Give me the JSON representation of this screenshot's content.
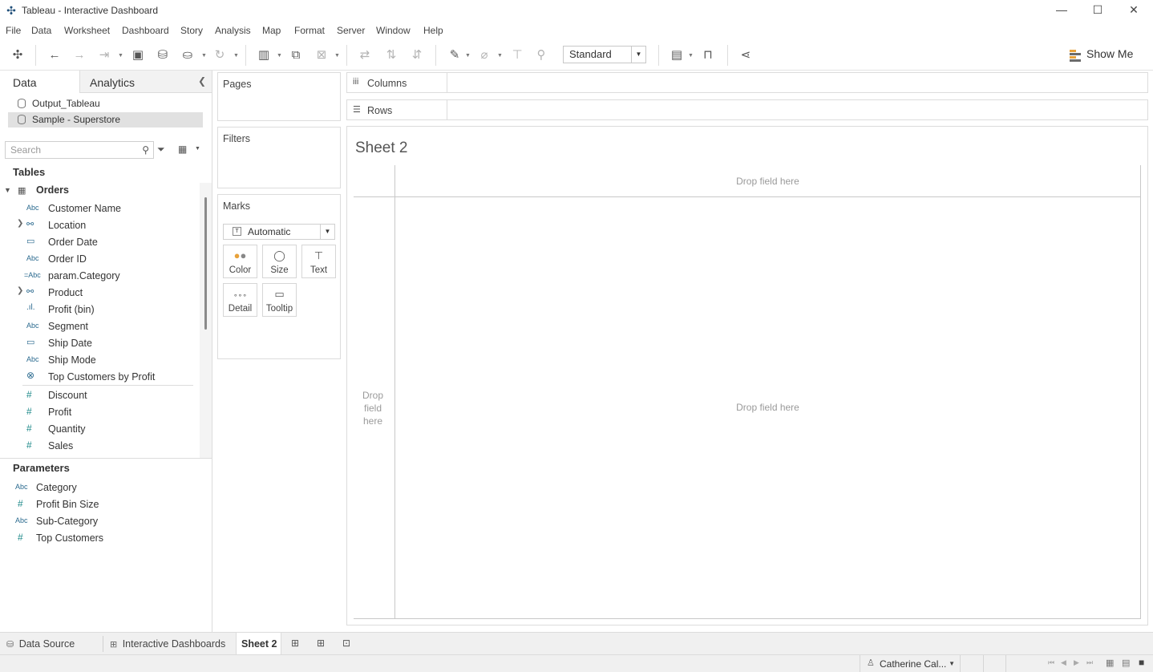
{
  "window": {
    "title": "Tableau - Interactive Dashboard",
    "minimize": "—",
    "maximize": "☐",
    "close": "✕"
  },
  "menu": [
    "File",
    "Data",
    "Worksheet",
    "Dashboard",
    "Story",
    "Analysis",
    "Map",
    "Format",
    "Server",
    "Window",
    "Help"
  ],
  "toolbar": {
    "fit_value": "Standard",
    "show_me_label": "Show Me"
  },
  "data_pane": {
    "tab_data": "Data",
    "tab_analytics": "Analytics",
    "datasources": [
      "Output_Tableau",
      "Sample - Superstore"
    ],
    "search_placeholder": "Search",
    "tables_header": "Tables",
    "table_name": "Orders",
    "dimensions": [
      {
        "type": "Abc",
        "name": "Customer Name"
      },
      {
        "type": "",
        "name": "Location"
      },
      {
        "type": "",
        "name": "Order Date"
      },
      {
        "type": "Abc",
        "name": "Order ID"
      },
      {
        "type": "=Abc",
        "name": "param.Category"
      },
      {
        "type": "",
        "name": "Product"
      },
      {
        "type": "",
        "name": "Profit (bin)"
      },
      {
        "type": "Abc",
        "name": "Segment"
      },
      {
        "type": "",
        "name": "Ship Date"
      },
      {
        "type": "Abc",
        "name": "Ship Mode"
      },
      {
        "type": "",
        "name": "Top Customers by Profit"
      }
    ],
    "measures": [
      {
        "type": "#",
        "name": "Discount"
      },
      {
        "type": "#",
        "name": "Profit"
      },
      {
        "type": "#",
        "name": "Quantity"
      },
      {
        "type": "#",
        "name": "Sales"
      }
    ],
    "parameters_header": "Parameters",
    "parameters": [
      {
        "type": "Abc",
        "name": "Category"
      },
      {
        "type": "#",
        "name": "Profit Bin Size"
      },
      {
        "type": "Abc",
        "name": "Sub-Category"
      },
      {
        "type": "#",
        "name": "Top Customers"
      }
    ]
  },
  "cards": {
    "pages": "Pages",
    "filters": "Filters",
    "marks": "Marks",
    "marks_type": "Automatic",
    "mark_buttons": [
      "Color",
      "Size",
      "Text",
      "Detail",
      "Tooltip"
    ]
  },
  "shelves": {
    "columns": "Columns",
    "rows": "Rows"
  },
  "view": {
    "sheet_title": "Sheet 2",
    "drop_top": "Drop field here",
    "drop_left": "Drop field here",
    "drop_center": "Drop field here"
  },
  "tabs": {
    "data_source": "Data Source",
    "dashboard": "Interactive Dashboards",
    "active_sheet": "Sheet 2"
  },
  "status": {
    "user": "Catherine Cal..."
  }
}
